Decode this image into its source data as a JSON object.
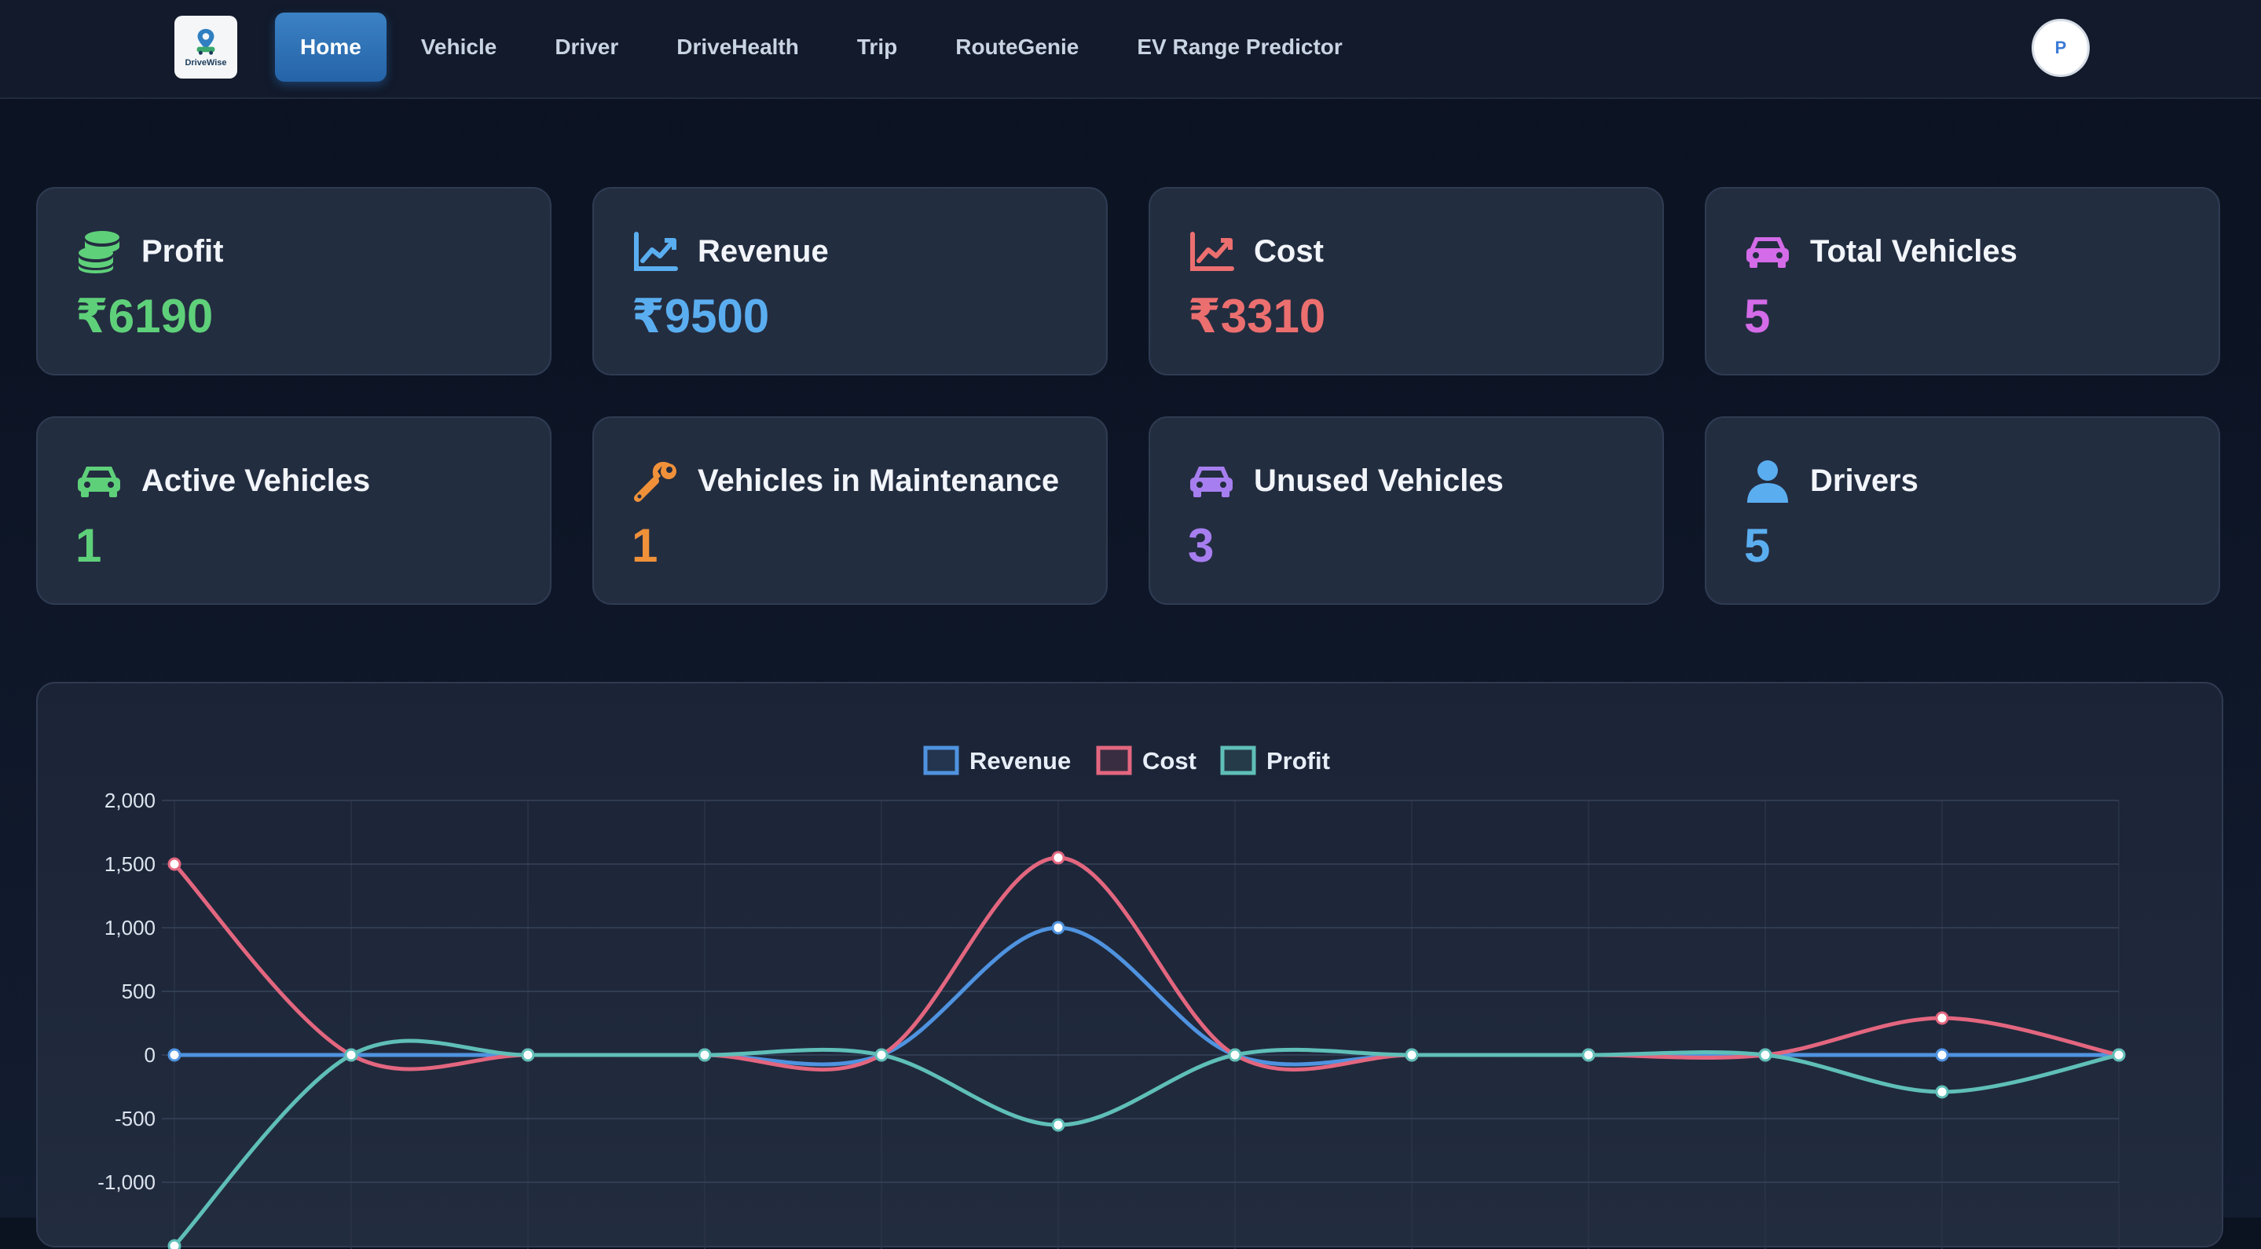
{
  "nav": {
    "logo_text": "DriveWise",
    "items": [
      {
        "label": "Home",
        "active": true
      },
      {
        "label": "Vehicle"
      },
      {
        "label": "Driver"
      },
      {
        "label": "DriveHealth"
      },
      {
        "label": "Trip"
      },
      {
        "label": "RouteGenie"
      },
      {
        "label": "EV Range Predictor"
      }
    ],
    "avatar_initial": "P"
  },
  "stats": [
    {
      "title": "Profit",
      "value": "₹6190",
      "icon": "coins-icon",
      "color": "#5fd07a"
    },
    {
      "title": "Revenue",
      "value": "₹9500",
      "icon": "chart-line-icon",
      "color": "#5aaef0"
    },
    {
      "title": "Cost",
      "value": "₹3310",
      "icon": "chart-line-icon",
      "color": "#ec6f6f"
    },
    {
      "title": "Total Vehicles",
      "value": "5",
      "icon": "car-icon",
      "color": "#d46be8"
    },
    {
      "title": "Active Vehicles",
      "value": "1",
      "icon": "car-icon",
      "color": "#5fd07a"
    },
    {
      "title": "Vehicles in Maintenance",
      "value": "1",
      "icon": "wrench-icon",
      "color": "#f0913a"
    },
    {
      "title": "Unused Vehicles",
      "value": "3",
      "icon": "car-icon",
      "color": "#a77ef0"
    },
    {
      "title": "Drivers",
      "value": "5",
      "icon": "user-icon",
      "color": "#5aaef0"
    }
  ],
  "chart_data": {
    "type": "line",
    "x": [
      0,
      1,
      2,
      3,
      4,
      5,
      6,
      7,
      8,
      9,
      10,
      11
    ],
    "ylim": [
      -1000,
      2000
    ],
    "yticks": [
      "2,000",
      "1,500",
      "1,000",
      "500",
      "0",
      "-500",
      "-1,000"
    ],
    "grid": true,
    "legend_position": "top-center",
    "series": [
      {
        "name": "Revenue",
        "color": "#4f93e0",
        "values": [
          0,
          0,
          0,
          0,
          0,
          1000,
          0,
          0,
          0,
          0,
          0,
          0
        ]
      },
      {
        "name": "Cost",
        "color": "#e3667f",
        "values": [
          1500,
          0,
          0,
          0,
          0,
          1550,
          0,
          0,
          0,
          0,
          290,
          0
        ]
      },
      {
        "name": "Profit",
        "color": "#5fbfb8",
        "values": [
          -1500,
          0,
          0,
          0,
          0,
          -550,
          0,
          0,
          0,
          0,
          -290,
          0
        ]
      }
    ]
  }
}
